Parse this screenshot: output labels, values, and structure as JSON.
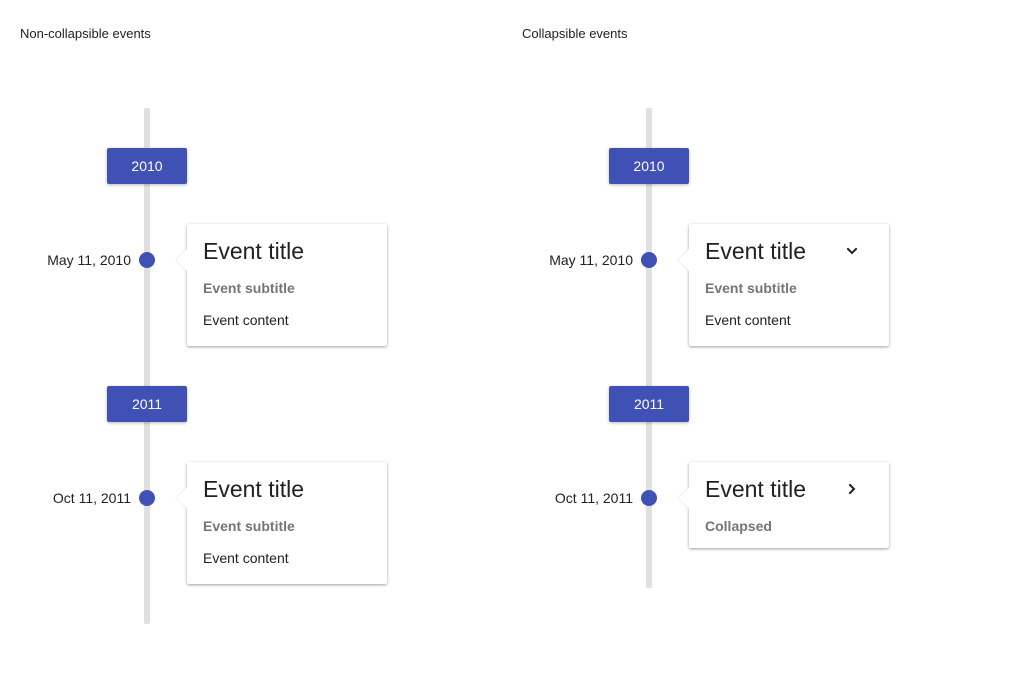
{
  "sections": {
    "non_collapsible": {
      "title": "Non-collapsible events",
      "years": [
        "2010",
        "2011"
      ],
      "events": [
        {
          "date": "May 11, 2010",
          "title": "Event title",
          "subtitle": "Event subtitle",
          "content": "Event content"
        },
        {
          "date": "Oct 11, 2011",
          "title": "Event title",
          "subtitle": "Event subtitle",
          "content": "Event content"
        }
      ]
    },
    "collapsible": {
      "title": "Collapsible events",
      "years": [
        "2010",
        "2011"
      ],
      "events": [
        {
          "date": "May 11, 2010",
          "title": "Event title",
          "subtitle": "Event subtitle",
          "content": "Event content",
          "toggle_icon": "chevron-down-icon",
          "expanded": true
        },
        {
          "date": "Oct 11, 2011",
          "title": "Event title",
          "subtitle": "Collapsed",
          "toggle_icon": "chevron-right-icon",
          "expanded": false
        }
      ]
    }
  },
  "colors": {
    "accent": "#3f51b5",
    "line": "#e0e0e0",
    "subtitle": "#757575",
    "text": "#212121"
  }
}
